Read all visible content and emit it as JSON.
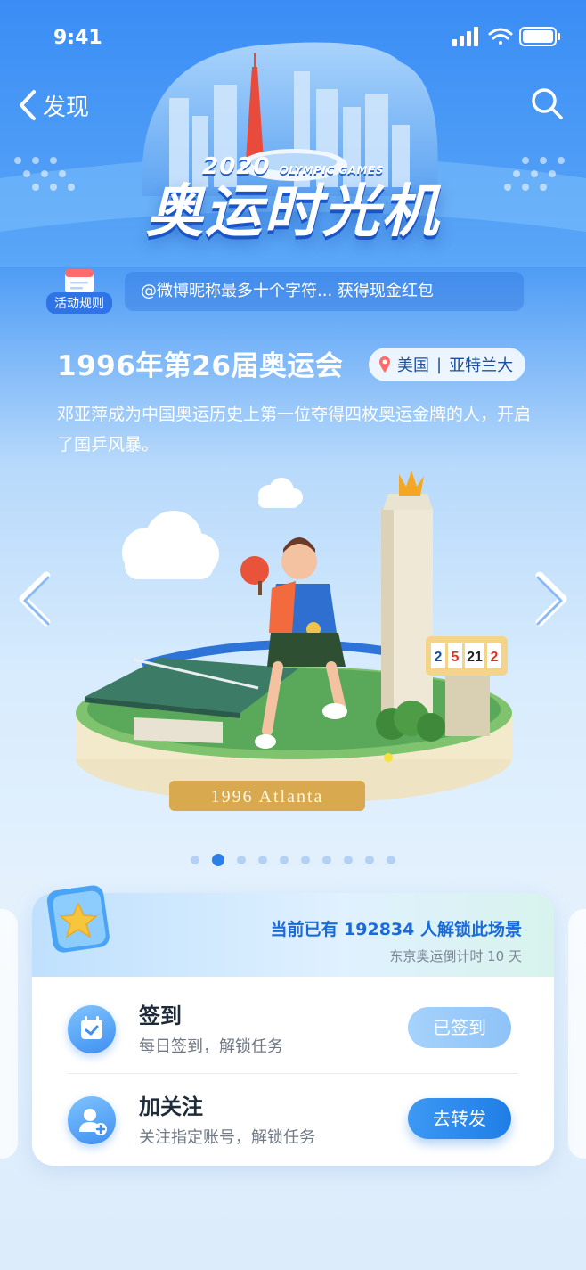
{
  "status_bar": {
    "time": "9:41"
  },
  "nav": {
    "back_label": "发现"
  },
  "hero": {
    "year": "2020",
    "games": "OLYMPIC GAMES",
    "title": "奥运时光机"
  },
  "rules": {
    "label": "活动规则"
  },
  "notice": {
    "text": "@微博昵称最多十个字符... 获得现金红包"
  },
  "event": {
    "title": "1996年第26届奥运会",
    "country": "美国",
    "city": "亚特兰大",
    "description": "邓亚萍成为中国奥运历史上第一位夺得四枚奥运金牌的人，开启了国乒风暴。"
  },
  "scene": {
    "plaque": "1996 Atlanta",
    "scoreboard": [
      "2",
      "5",
      "21",
      "2"
    ]
  },
  "carousel": {
    "total": 10,
    "active_index": 1
  },
  "task_card": {
    "unlock_text": "当前已有 192834 人解锁此场景",
    "countdown": "东京奥运倒计时 10 天",
    "tasks": [
      {
        "title": "签到",
        "subtitle": "每日签到，解锁任务",
        "button": "已签到"
      },
      {
        "title": "加关注",
        "subtitle": "关注指定账号，解锁任务",
        "button": "去转发"
      }
    ]
  },
  "colors": {
    "primary": "#2c7ee8",
    "sky_top": "#2f86f2",
    "sky_bottom": "#e4f1fd",
    "unlock_text": "#1a6bd8"
  },
  "icons": [
    "back-chevron-icon",
    "search-icon",
    "calendar-icon",
    "pin-icon",
    "arrow-left-icon",
    "arrow-right-icon",
    "star-icon",
    "calendar-check-icon",
    "add-user-icon"
  ]
}
